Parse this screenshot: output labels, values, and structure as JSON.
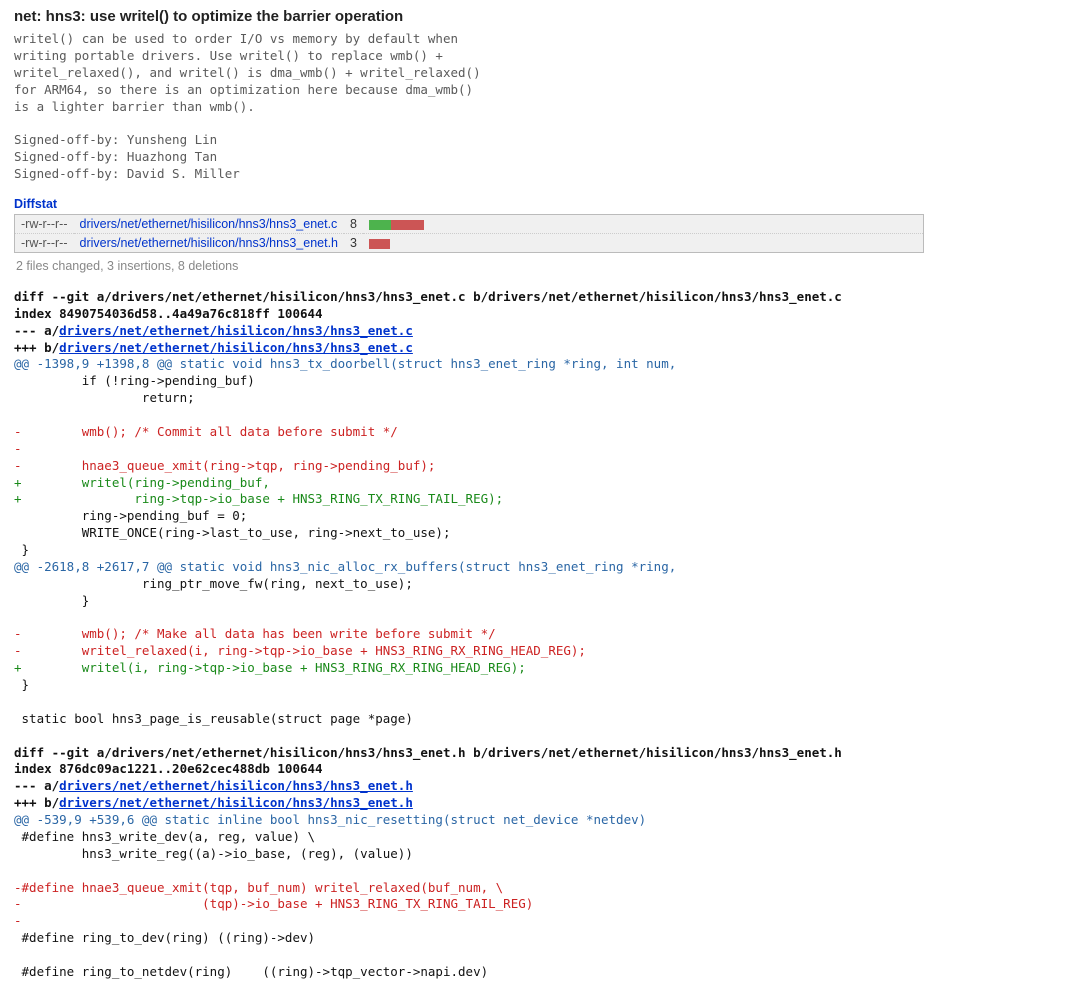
{
  "commit": {
    "title": "net: hns3: use writel() to optimize the barrier operation",
    "message": "writel() can be used to order I/O vs memory by default when\nwriting portable drivers. Use writel() to replace wmb() +\nwritel_relaxed(), and writel() is dma_wmb() + writel_relaxed()\nfor ARM64, so there is an optimization here because dma_wmb()\nis a lighter barrier than wmb().\n\nSigned-off-by: Yunsheng Lin\nSigned-off-by: Huazhong Tan\nSigned-off-by: David S. Miller"
  },
  "diffstat": {
    "heading": "Diffstat",
    "rows": [
      {
        "mode": "-rw-r--r--",
        "path": "drivers/net/ethernet/hisilicon/hns3/hns3_enet.c",
        "count": "8",
        "add_w": 22,
        "del_w": 33
      },
      {
        "mode": "-rw-r--r--",
        "path": "drivers/net/ethernet/hisilicon/hns3/hns3_enet.h",
        "count": "3",
        "add_w": 0,
        "del_w": 21
      }
    ],
    "summary": "2 files changed, 3 insertions, 8 deletions"
  },
  "diffs": [
    {
      "cmd": "diff --git a/drivers/net/ethernet/hisilicon/hns3/hns3_enet.c b/drivers/net/ethernet/hisilicon/hns3/hns3_enet.c",
      "index": "index 8490754036d58..4a49a76c818ff 100644",
      "minus_pre": "--- a/",
      "minus_path": "drivers/net/ethernet/hisilicon/hns3/hns3_enet.c",
      "plus_pre": "+++ b/",
      "plus_path": "drivers/net/ethernet/hisilicon/hns3/hns3_enet.c",
      "lines": [
        {
          "t": "hunk",
          "s": "@@ -1398,9 +1398,8 @@ static void hns3_tx_doorbell(struct hns3_enet_ring *ring, int num,"
        },
        {
          "t": "ctx",
          "s": "         if (!ring->pending_buf)"
        },
        {
          "t": "ctx",
          "s": "                 return;"
        },
        {
          "t": "ctx",
          "s": ""
        },
        {
          "t": "del",
          "s": "-        wmb(); /* Commit all data before submit */"
        },
        {
          "t": "del",
          "s": "-"
        },
        {
          "t": "del",
          "s": "-        hnae3_queue_xmit(ring->tqp, ring->pending_buf);"
        },
        {
          "t": "add",
          "s": "+        writel(ring->pending_buf,"
        },
        {
          "t": "add",
          "s": "+               ring->tqp->io_base + HNS3_RING_TX_RING_TAIL_REG);"
        },
        {
          "t": "ctx",
          "s": "         ring->pending_buf = 0;"
        },
        {
          "t": "ctx",
          "s": "         WRITE_ONCE(ring->last_to_use, ring->next_to_use);"
        },
        {
          "t": "ctx",
          "s": " }"
        },
        {
          "t": "hunk",
          "s": "@@ -2618,8 +2617,7 @@ static void hns3_nic_alloc_rx_buffers(struct hns3_enet_ring *ring,"
        },
        {
          "t": "ctx",
          "s": "                 ring_ptr_move_fw(ring, next_to_use);"
        },
        {
          "t": "ctx",
          "s": "         }"
        },
        {
          "t": "ctx",
          "s": ""
        },
        {
          "t": "del",
          "s": "-        wmb(); /* Make all data has been write before submit */"
        },
        {
          "t": "del",
          "s": "-        writel_relaxed(i, ring->tqp->io_base + HNS3_RING_RX_RING_HEAD_REG);"
        },
        {
          "t": "add",
          "s": "+        writel(i, ring->tqp->io_base + HNS3_RING_RX_RING_HEAD_REG);"
        },
        {
          "t": "ctx",
          "s": " }"
        },
        {
          "t": "ctx",
          "s": ""
        },
        {
          "t": "ctx",
          "s": " static bool hns3_page_is_reusable(struct page *page)"
        }
      ]
    },
    {
      "cmd": "diff --git a/drivers/net/ethernet/hisilicon/hns3/hns3_enet.h b/drivers/net/ethernet/hisilicon/hns3/hns3_enet.h",
      "index": "index 876dc09ac1221..20e62cec488db 100644",
      "minus_pre": "--- a/",
      "minus_path": "drivers/net/ethernet/hisilicon/hns3/hns3_enet.h",
      "plus_pre": "+++ b/",
      "plus_path": "drivers/net/ethernet/hisilicon/hns3/hns3_enet.h",
      "lines": [
        {
          "t": "hunk",
          "s": "@@ -539,9 +539,6 @@ static inline bool hns3_nic_resetting(struct net_device *netdev)"
        },
        {
          "t": "ctx",
          "s": " #define hns3_write_dev(a, reg, value) \\"
        },
        {
          "t": "ctx",
          "s": "         hns3_write_reg((a)->io_base, (reg), (value))"
        },
        {
          "t": "ctx",
          "s": ""
        },
        {
          "t": "del",
          "s": "-#define hnae3_queue_xmit(tqp, buf_num) writel_relaxed(buf_num, \\"
        },
        {
          "t": "del",
          "s": "-                        (tqp)->io_base + HNS3_RING_TX_RING_TAIL_REG)"
        },
        {
          "t": "del",
          "s": "-"
        },
        {
          "t": "ctx",
          "s": " #define ring_to_dev(ring) ((ring)->dev)"
        },
        {
          "t": "ctx",
          "s": ""
        },
        {
          "t": "ctx",
          "s": " #define ring_to_netdev(ring)    ((ring)->tqp_vector->napi.dev)"
        }
      ]
    }
  ]
}
